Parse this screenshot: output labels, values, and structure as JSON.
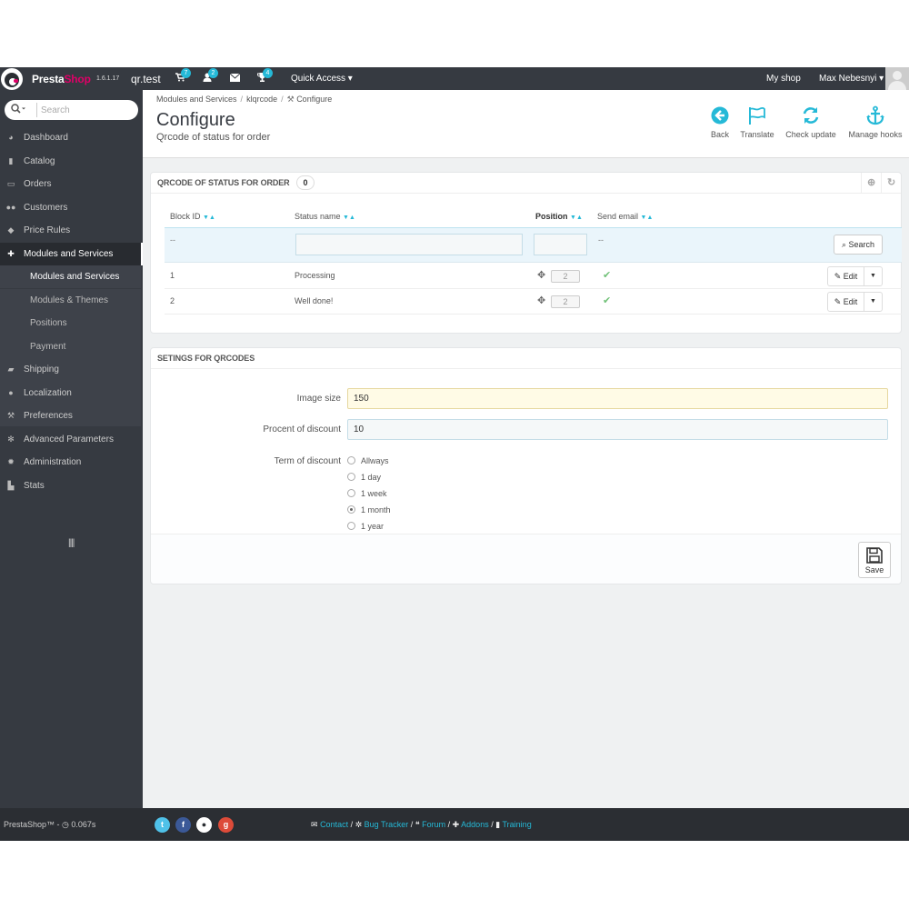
{
  "header": {
    "brand_presta": "Presta",
    "brand_shop": "Shop",
    "version": "1.6.1.17",
    "shop_name": "qr.test",
    "badges": {
      "orders": "7",
      "customers": "2",
      "messages": "",
      "achievements": "4"
    },
    "quick_access": "Quick Access ▾",
    "my_shop": "My shop",
    "user": "Max Nebesnyi ▾"
  },
  "sidebar": {
    "search_placeholder": "Search",
    "items": [
      {
        "label": "Dashboard",
        "icon": "dashboard-icon"
      },
      {
        "label": "Catalog",
        "icon": "book-icon"
      },
      {
        "label": "Orders",
        "icon": "credit-card-icon"
      },
      {
        "label": "Customers",
        "icon": "users-icon"
      },
      {
        "label": "Price Rules",
        "icon": "tags-icon"
      },
      {
        "label": "Modules and Services",
        "icon": "puzzle-icon"
      },
      {
        "label": "Shipping",
        "icon": "truck-icon"
      },
      {
        "label": "Localization",
        "icon": "globe-icon"
      },
      {
        "label": "Preferences",
        "icon": "wrench-icon"
      },
      {
        "label": "Advanced Parameters",
        "icon": "cogs-icon"
      },
      {
        "label": "Administration",
        "icon": "cog-icon"
      },
      {
        "label": "Stats",
        "icon": "bar-chart-icon"
      }
    ],
    "sub_items": [
      {
        "label": "Modules and Services"
      },
      {
        "label": "Modules & Themes Catalog"
      },
      {
        "label": "Positions"
      },
      {
        "label": "Payment"
      }
    ],
    "collapse": "||||"
  },
  "toolbar": {
    "breadcrumb": [
      "Modules and Services",
      "klqrcode",
      "Configure"
    ],
    "title": "Configure",
    "subtitle": "Qrcode of status for order",
    "buttons": {
      "back": "Back",
      "translate": "Translate",
      "check_update": "Check update",
      "manage_hooks": "Manage hooks"
    }
  },
  "list_panel": {
    "title": "Qrcode of status for order",
    "count": "0",
    "columns": {
      "block_id": "Block ID",
      "status_name": "Status name",
      "position": "Position",
      "send_email": "Send email"
    },
    "filter": {
      "block_id": "--",
      "send_email": "--",
      "search_label": "Search"
    },
    "rows": [
      {
        "id": "1",
        "status": "Processing",
        "position": "2",
        "edit": "Edit"
      },
      {
        "id": "2",
        "status": "Well done!",
        "position": "2",
        "edit": "Edit"
      }
    ]
  },
  "settings_panel": {
    "title": "Setings for qrcodes",
    "image_size_label": "Image size",
    "image_size_value": "150",
    "discount_label": "Procent of discount",
    "discount_value": "10",
    "term_label": "Term of discount",
    "term_options": [
      "Allways",
      "1 day",
      "1 week",
      "1 month",
      "1 year"
    ],
    "term_selected": "1 month",
    "save_label": "Save"
  },
  "footer": {
    "copyright": "PrestaShop™ - ◷ 0.067s",
    "links": {
      "contact": "Contact",
      "bug_tracker": "Bug Tracker",
      "forum": "Forum",
      "addons": "Addons",
      "training": "Training"
    }
  },
  "colors": {
    "header_bg": "#363a41",
    "accent": "#25b9d7",
    "brand_pink": "#df0067",
    "check_green": "#72c279",
    "image_size_bg": "#fffbe6"
  }
}
